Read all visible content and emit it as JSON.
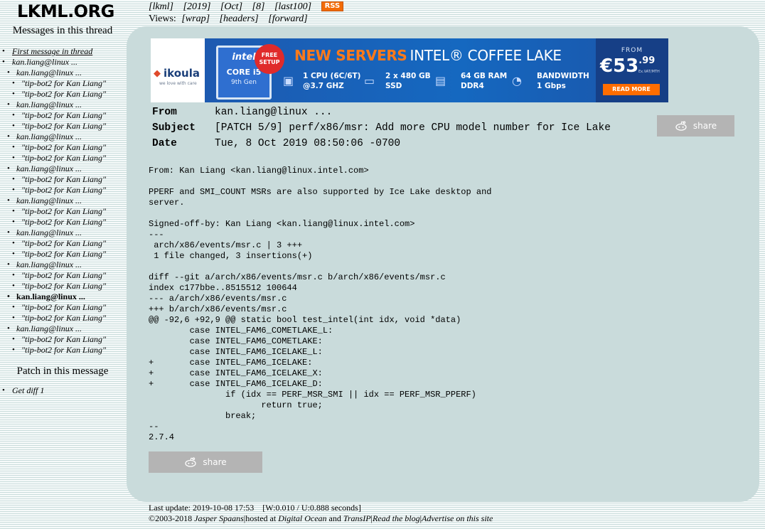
{
  "site": {
    "logo": "LKML.ORG"
  },
  "sidebar": {
    "thread_heading": "Messages in this thread",
    "thread_items": [
      {
        "label": "First message in thread",
        "level": 0,
        "kind": "first"
      },
      {
        "label": "kan.liang@linux ...",
        "level": 0
      },
      {
        "label": "kan.liang@linux ...",
        "level": 1
      },
      {
        "label": "\"tip-bot2 for Kan Liang\"",
        "level": 2
      },
      {
        "label": "\"tip-bot2 for Kan Liang\"",
        "level": 2
      },
      {
        "label": "kan.liang@linux ...",
        "level": 1
      },
      {
        "label": "\"tip-bot2 for Kan Liang\"",
        "level": 2
      },
      {
        "label": "\"tip-bot2 for Kan Liang\"",
        "level": 2
      },
      {
        "label": "kan.liang@linux ...",
        "level": 1
      },
      {
        "label": "\"tip-bot2 for Kan Liang\"",
        "level": 2
      },
      {
        "label": "\"tip-bot2 for Kan Liang\"",
        "level": 2
      },
      {
        "label": "kan.liang@linux ...",
        "level": 1
      },
      {
        "label": "\"tip-bot2 for Kan Liang\"",
        "level": 2
      },
      {
        "label": "\"tip-bot2 for Kan Liang\"",
        "level": 2
      },
      {
        "label": "kan.liang@linux ...",
        "level": 1
      },
      {
        "label": "\"tip-bot2 for Kan Liang\"",
        "level": 2
      },
      {
        "label": "\"tip-bot2 for Kan Liang\"",
        "level": 2
      },
      {
        "label": "kan.liang@linux ...",
        "level": 1
      },
      {
        "label": "\"tip-bot2 for Kan Liang\"",
        "level": 2
      },
      {
        "label": "\"tip-bot2 for Kan Liang\"",
        "level": 2
      },
      {
        "label": "kan.liang@linux ...",
        "level": 1
      },
      {
        "label": "\"tip-bot2 for Kan Liang\"",
        "level": 2
      },
      {
        "label": "\"tip-bot2 for Kan Liang\"",
        "level": 2
      },
      {
        "label": "kan.liang@linux ...",
        "level": 1,
        "kind": "current"
      },
      {
        "label": "\"tip-bot2 for Kan Liang\"",
        "level": 2
      },
      {
        "label": "\"tip-bot2 for Kan Liang\"",
        "level": 2
      },
      {
        "label": "kan.liang@linux ...",
        "level": 1
      },
      {
        "label": "\"tip-bot2 for Kan Liang\"",
        "level": 2
      },
      {
        "label": "\"tip-bot2 for Kan Liang\"",
        "level": 2
      }
    ],
    "patch_heading": "Patch in this message",
    "patch_items": [
      {
        "label": "Get diff 1"
      }
    ]
  },
  "topnav": {
    "crumbs": [
      "[lkml]",
      "[2019]",
      "[Oct]",
      "[8]",
      "[last100]"
    ],
    "rss": "RSS",
    "views_label": "Views:",
    "views": [
      "[wrap]",
      "[headers]",
      "[forward]"
    ]
  },
  "banner": {
    "brand": "ikoula",
    "brand_tagline": "we love with care",
    "chip_brand": "intel",
    "chip_model": "CORE i5",
    "chip_gen": "9th Gen",
    "free_badge": "FREE SETUP",
    "headline_a": "NEW SERVERS",
    "headline_b": "INTEL® COFFEE LAKE",
    "spec_cpu": "1 CPU (6C/6T)\n@3.7 GHZ",
    "spec_ssd": "2 x 480 GB\nSSD",
    "spec_ram": "64 GB RAM\nDDR4",
    "spec_bw": "BANDWIDTH\n1 Gbps",
    "price_from": "FROM",
    "price_main": "€53",
    "price_cents": ".99",
    "price_vat": "Ex.VAT/MTH",
    "cta": "READ MORE"
  },
  "message": {
    "headers": [
      {
        "key": "From",
        "value": "kan.liang@linux ..."
      },
      {
        "key": "Subject",
        "value": "[PATCH 5/9] perf/x86/msr: Add more CPU model number for Ice Lake"
      },
      {
        "key": "Date",
        "value": "Tue, 8 Oct 2019 08:50:06 -0700"
      }
    ],
    "share_label": "share",
    "body": "From: Kan Liang <kan.liang@linux.intel.com>\n\nPPERF and SMI_COUNT MSRs are also supported by Ice Lake desktop and\nserver.\n\nSigned-off-by: Kan Liang <kan.liang@linux.intel.com>\n---\n arch/x86/events/msr.c | 3 +++\n 1 file changed, 3 insertions(+)\n\ndiff --git a/arch/x86/events/msr.c b/arch/x86/events/msr.c\nindex c177bbe..8515512 100644\n--- a/arch/x86/events/msr.c\n+++ b/arch/x86/events/msr.c\n@@ -92,6 +92,9 @@ static bool test_intel(int idx, void *data)\n        case INTEL_FAM6_COMETLAKE_L:\n        case INTEL_FAM6_COMETLAKE:\n        case INTEL_FAM6_ICELAKE_L:\n+       case INTEL_FAM6_ICELAKE:\n+       case INTEL_FAM6_ICELAKE_X:\n+       case INTEL_FAM6_ICELAKE_D:\n               if (idx == PERF_MSR_SMI || idx == PERF_MSR_PPERF)\n                      return true;\n               break;\n--\n2.7.4"
  },
  "footer": {
    "last_update": "Last update: 2019-10-08 17:53    [W:0.010 / U:0.888 seconds]",
    "copyright": "©2003-2018",
    "author": "Jasper Spaans",
    "hosted_sep": "|hosted at",
    "host": "Digital Ocean",
    "and": "and",
    "transip": "TransIP",
    "blog": "Read the blog",
    "advertise": "Advertise on this site"
  }
}
